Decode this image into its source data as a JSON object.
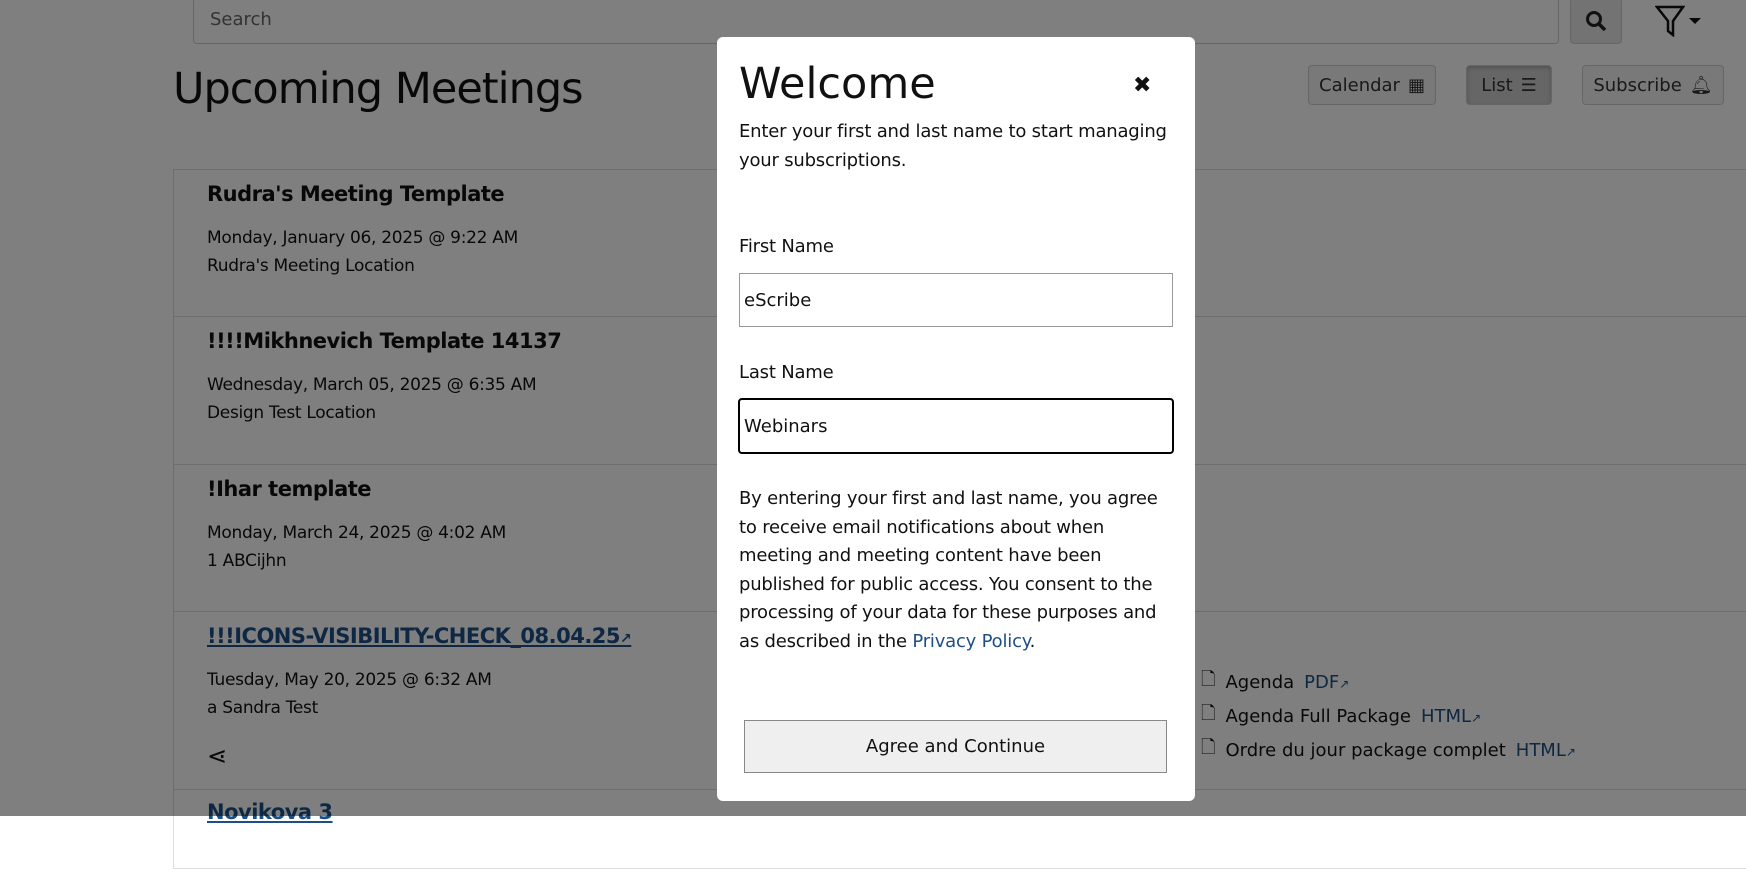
{
  "header": {
    "search_placeholder": "Search",
    "title": "Upcoming Meetings",
    "calendar": "Calendar",
    "list": "List",
    "subscribe": "Subscribe"
  },
  "meetings": [
    {
      "title": "Rudra's Meeting Template",
      "date": "Monday, January 06, 2025 @ 9:22 AM",
      "location": "Rudra's Meeting Location"
    },
    {
      "title": "!!!!Mikhnevich Template 14137",
      "date": "Wednesday, March 05, 2025 @ 6:35 AM",
      "location": "Design Test Location"
    },
    {
      "title": "!Ihar template",
      "date": "Monday, March 24, 2025 @ 4:02 AM",
      "location": "1 ABCijhn"
    },
    {
      "title": "!!!ICONS-VISIBILITY-CHECK_08.04.25",
      "date": "Tuesday, May 20, 2025 @ 6:32 AM",
      "location": "a Sandra Test",
      "documents": [
        {
          "name": "Agenda",
          "link": "PDF"
        },
        {
          "name": "Agenda Full Package",
          "link": "HTML"
        },
        {
          "name": "Ordre du jour package complet",
          "link": "HTML"
        }
      ]
    },
    {
      "title": "Novikova 3"
    }
  ],
  "modal": {
    "title": "Welcome",
    "intro": "Enter your first and last name to start managing your subscriptions.",
    "first_label": "First Name",
    "first_value": "eScribe",
    "last_label": "Last Name",
    "last_value": "Webinars",
    "consent": "By entering your first and last name, you agree to receive email notifications about when meeting and meeting content have been published for public access. You consent to the processing of your data for these purposes and as described in the ",
    "privacy": "Privacy Policy",
    "period": ".",
    "agree": "Agree and Continue"
  },
  "colors": {
    "link": "#1c4f86",
    "overlay": "rgba(0,0,0,0.5)"
  }
}
